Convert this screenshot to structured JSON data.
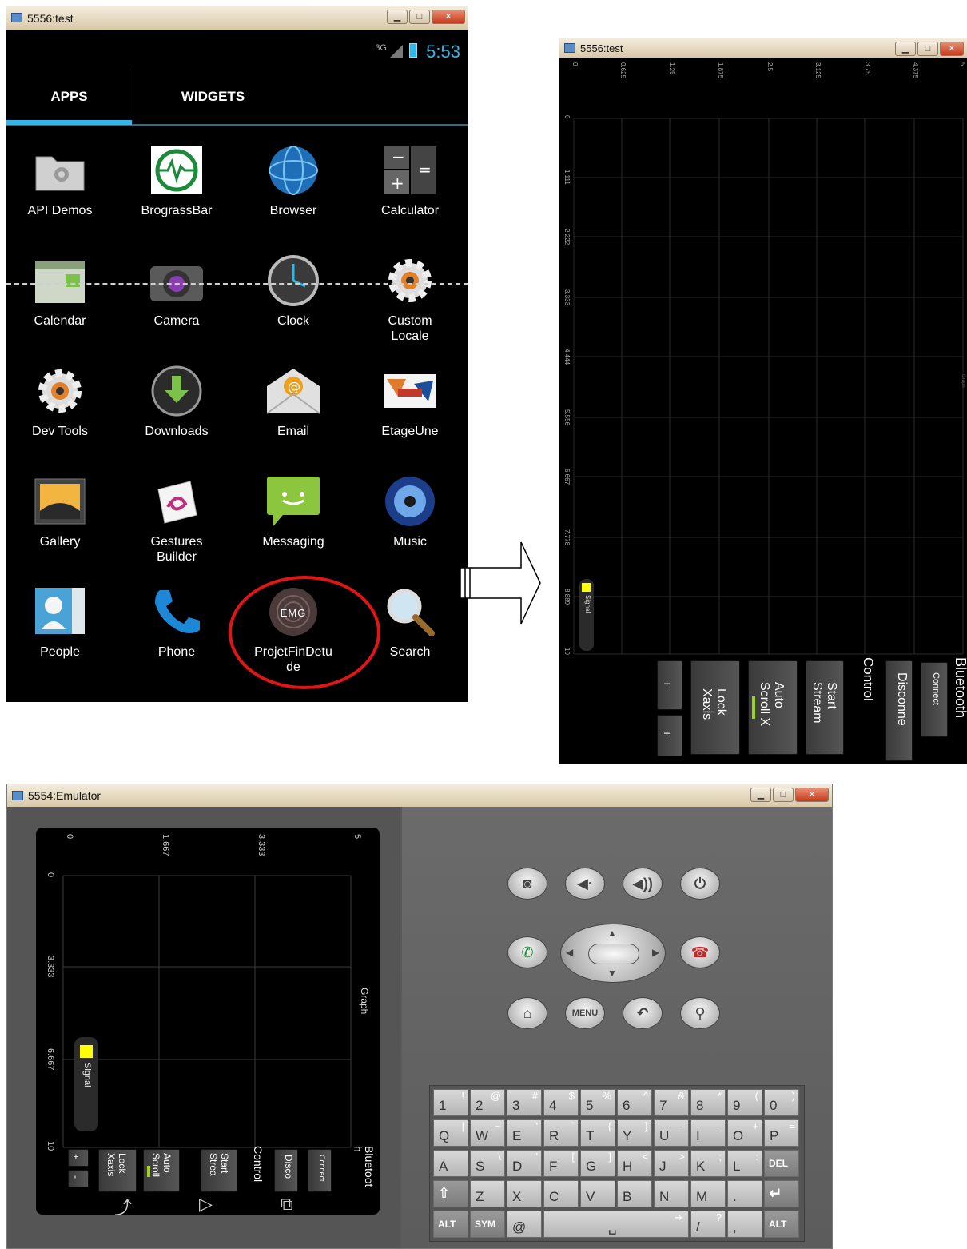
{
  "window1": {
    "title": "5556:test",
    "status": {
      "network": "3G",
      "clock": "5:53"
    },
    "tabs": [
      {
        "label": "APPS"
      },
      {
        "label": "WIDGETS"
      }
    ],
    "apps": [
      {
        "label": "API Demos",
        "icon": "folder-gear-icon"
      },
      {
        "label": "BrograssBar",
        "icon": "heartbeat-icon"
      },
      {
        "label": "Browser",
        "icon": "globe-icon"
      },
      {
        "label": "Calculator",
        "icon": "calculator-icon"
      },
      {
        "label": "Calendar",
        "icon": "calendar-icon"
      },
      {
        "label": "Camera",
        "icon": "camera-icon"
      },
      {
        "label": "Clock",
        "icon": "clock-icon"
      },
      {
        "label": "Custom\nLocale",
        "icon": "gear-icon"
      },
      {
        "label": "Dev Tools",
        "icon": "gear-icon"
      },
      {
        "label": "Downloads",
        "icon": "download-icon"
      },
      {
        "label": "Email",
        "icon": "email-icon"
      },
      {
        "label": "EtageUne",
        "icon": "etageune-icon"
      },
      {
        "label": "Gallery",
        "icon": "gallery-icon"
      },
      {
        "label": "Gestures\nBuilder",
        "icon": "gestures-icon"
      },
      {
        "label": "Messaging",
        "icon": "messaging-icon"
      },
      {
        "label": "Music",
        "icon": "speaker-icon"
      },
      {
        "label": "People",
        "icon": "people-icon"
      },
      {
        "label": "Phone",
        "icon": "phone-icon"
      },
      {
        "label": "ProjetFinDetu\nde",
        "icon": "emg-logo-icon",
        "logo_text": "EMG"
      },
      {
        "label": "Search",
        "icon": "magnifier-icon"
      }
    ],
    "colors": {
      "accent": "#33b5e5",
      "annotation": "#e01515"
    }
  },
  "window2": {
    "title": "5556:test",
    "x_ticks": [
      "0",
      "0.625",
      "1.25",
      "1.875",
      "2.5",
      "3.125",
      "3.75",
      "4.375",
      "5"
    ],
    "y_ticks": [
      "0",
      "1.111",
      "2.222",
      "3.333",
      "4.444",
      "5.556",
      "6.667",
      "7.778",
      "8.889",
      "10"
    ],
    "graph_label": "Graph",
    "legend": "Signal",
    "controls": {
      "plus1": "+",
      "plus2": "+",
      "lock": "Lock\nXaxis",
      "auto": "Auto\nScroll X",
      "start": "Start\nStream",
      "control_label": "Control",
      "disconnect": "Disconne",
      "connect": "Connect",
      "bluetooth_label": "Bluetooth"
    }
  },
  "window3": {
    "title": "5554:Emulator",
    "x_ticks": [
      "0",
      "1.667",
      "3.333",
      "5"
    ],
    "y_ticks": [
      "0",
      "3.333",
      "6.667",
      "10"
    ],
    "graph_label": "Graph",
    "legend": "Signal",
    "controls": {
      "plus": "+",
      "minus": "-",
      "lock": "Lock\nXaxis",
      "auto": "Auto\nScroll",
      "start": "Start\nStrea",
      "control_label": "Control",
      "disconnect": "Disco",
      "connect": "Connect",
      "bluetooth_label": "Bluetoot\nh"
    },
    "hw_buttons": {
      "menu": "MENU"
    },
    "keyboard": {
      "row1": [
        [
          "1",
          "!"
        ],
        [
          "2",
          "@"
        ],
        [
          "3",
          "#"
        ],
        [
          "4",
          "$"
        ],
        [
          "5",
          "%"
        ],
        [
          "6",
          "^"
        ],
        [
          "7",
          "&"
        ],
        [
          "8",
          "*"
        ],
        [
          "9",
          "("
        ],
        [
          "0",
          ")"
        ]
      ],
      "row2": [
        [
          "Q",
          "|"
        ],
        [
          "W",
          "~"
        ],
        [
          "E",
          "\""
        ],
        [
          "R",
          "`"
        ],
        [
          "T",
          "{"
        ],
        [
          "Y",
          "}"
        ],
        [
          "U",
          "-"
        ],
        [
          "I",
          "-"
        ],
        [
          "O",
          "+"
        ],
        [
          "P",
          "="
        ]
      ],
      "row3": [
        [
          "A",
          ""
        ],
        [
          "S",
          "\\"
        ],
        [
          "D",
          "'"
        ],
        [
          "F",
          "["
        ],
        [
          "G",
          "]"
        ],
        [
          "H",
          "<"
        ],
        [
          "J",
          ">"
        ],
        [
          "K",
          ";"
        ],
        [
          "L",
          ":"
        ],
        [
          "DEL",
          ""
        ]
      ],
      "row4": [
        [
          "⇧",
          ""
        ],
        [
          "Z",
          ""
        ],
        [
          "X",
          ""
        ],
        [
          "C",
          ""
        ],
        [
          "V",
          ""
        ],
        [
          "B",
          ""
        ],
        [
          "N",
          ""
        ],
        [
          "M",
          ""
        ],
        [
          ".",
          ""
        ],
        [
          "↵",
          ""
        ]
      ],
      "row5": {
        "alt_left": "ALT",
        "sym": "SYM",
        "at": "@",
        "space": "␣",
        "tab": "⇥",
        "slash": "/",
        "question": "?",
        "comma": ",",
        "alt_right": "ALT"
      }
    }
  }
}
